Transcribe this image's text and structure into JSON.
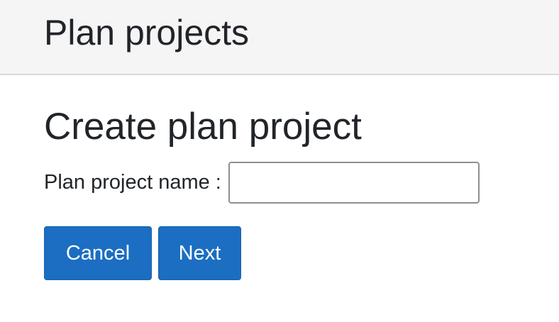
{
  "header": {
    "title": "Plan projects"
  },
  "main": {
    "heading": "Create plan project",
    "form": {
      "name_label": "Plan project name :",
      "name_value": "",
      "name_placeholder": ""
    },
    "buttons": {
      "cancel_label": "Cancel",
      "next_label": "Next"
    }
  },
  "colors": {
    "header_background": "#f5f5f5",
    "primary_button": "#1b6ec2",
    "text": "#212529"
  }
}
